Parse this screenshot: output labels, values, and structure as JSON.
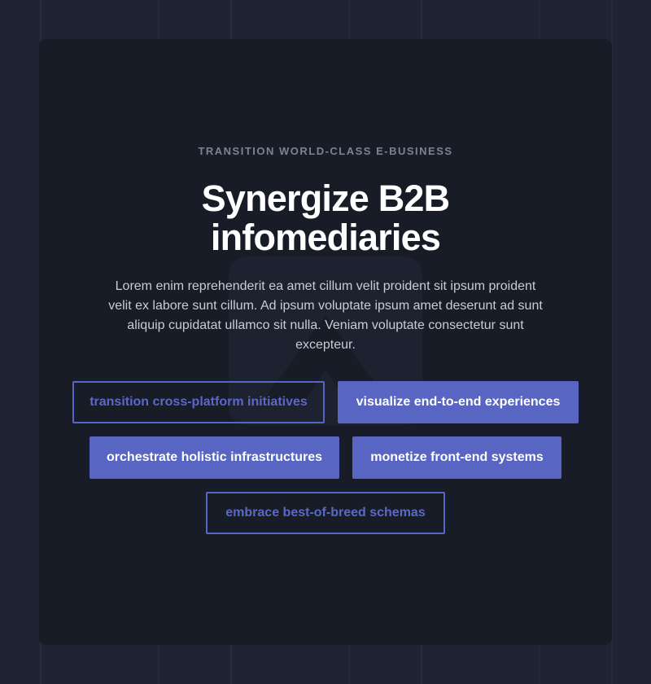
{
  "hero": {
    "eyebrow": "TRANSITION WORLD-CLASS E-BUSINESS",
    "title": "Synergize B2B infomediaries",
    "description": "Lorem enim reprehenderit ea amet cillum velit proident sit ipsum proident velit ex labore sunt cillum. Ad ipsum voluptate ipsum amet deserunt ad sunt aliquip cupidatat ullamco sit nulla. Veniam voluptate consectetur sunt excepteur.",
    "watermark_icon": "triangle-logo-icon"
  },
  "buttons": [
    {
      "label": "transition cross-platform initiatives",
      "style": "outline"
    },
    {
      "label": "visualize end-to-end experiences",
      "style": "solid"
    },
    {
      "label": "orchestrate holistic infrastructures",
      "style": "solid"
    },
    {
      "label": "monetize front-end systems",
      "style": "solid"
    },
    {
      "label": "embrace best-of-breed schemas",
      "style": "outline"
    }
  ],
  "colors": {
    "page_background": "#1e2433",
    "card_background": "#181c27",
    "accent": "#5865c2",
    "title": "#ffffff",
    "eyebrow": "#7a8396",
    "body_text": "#c9ccd4"
  }
}
